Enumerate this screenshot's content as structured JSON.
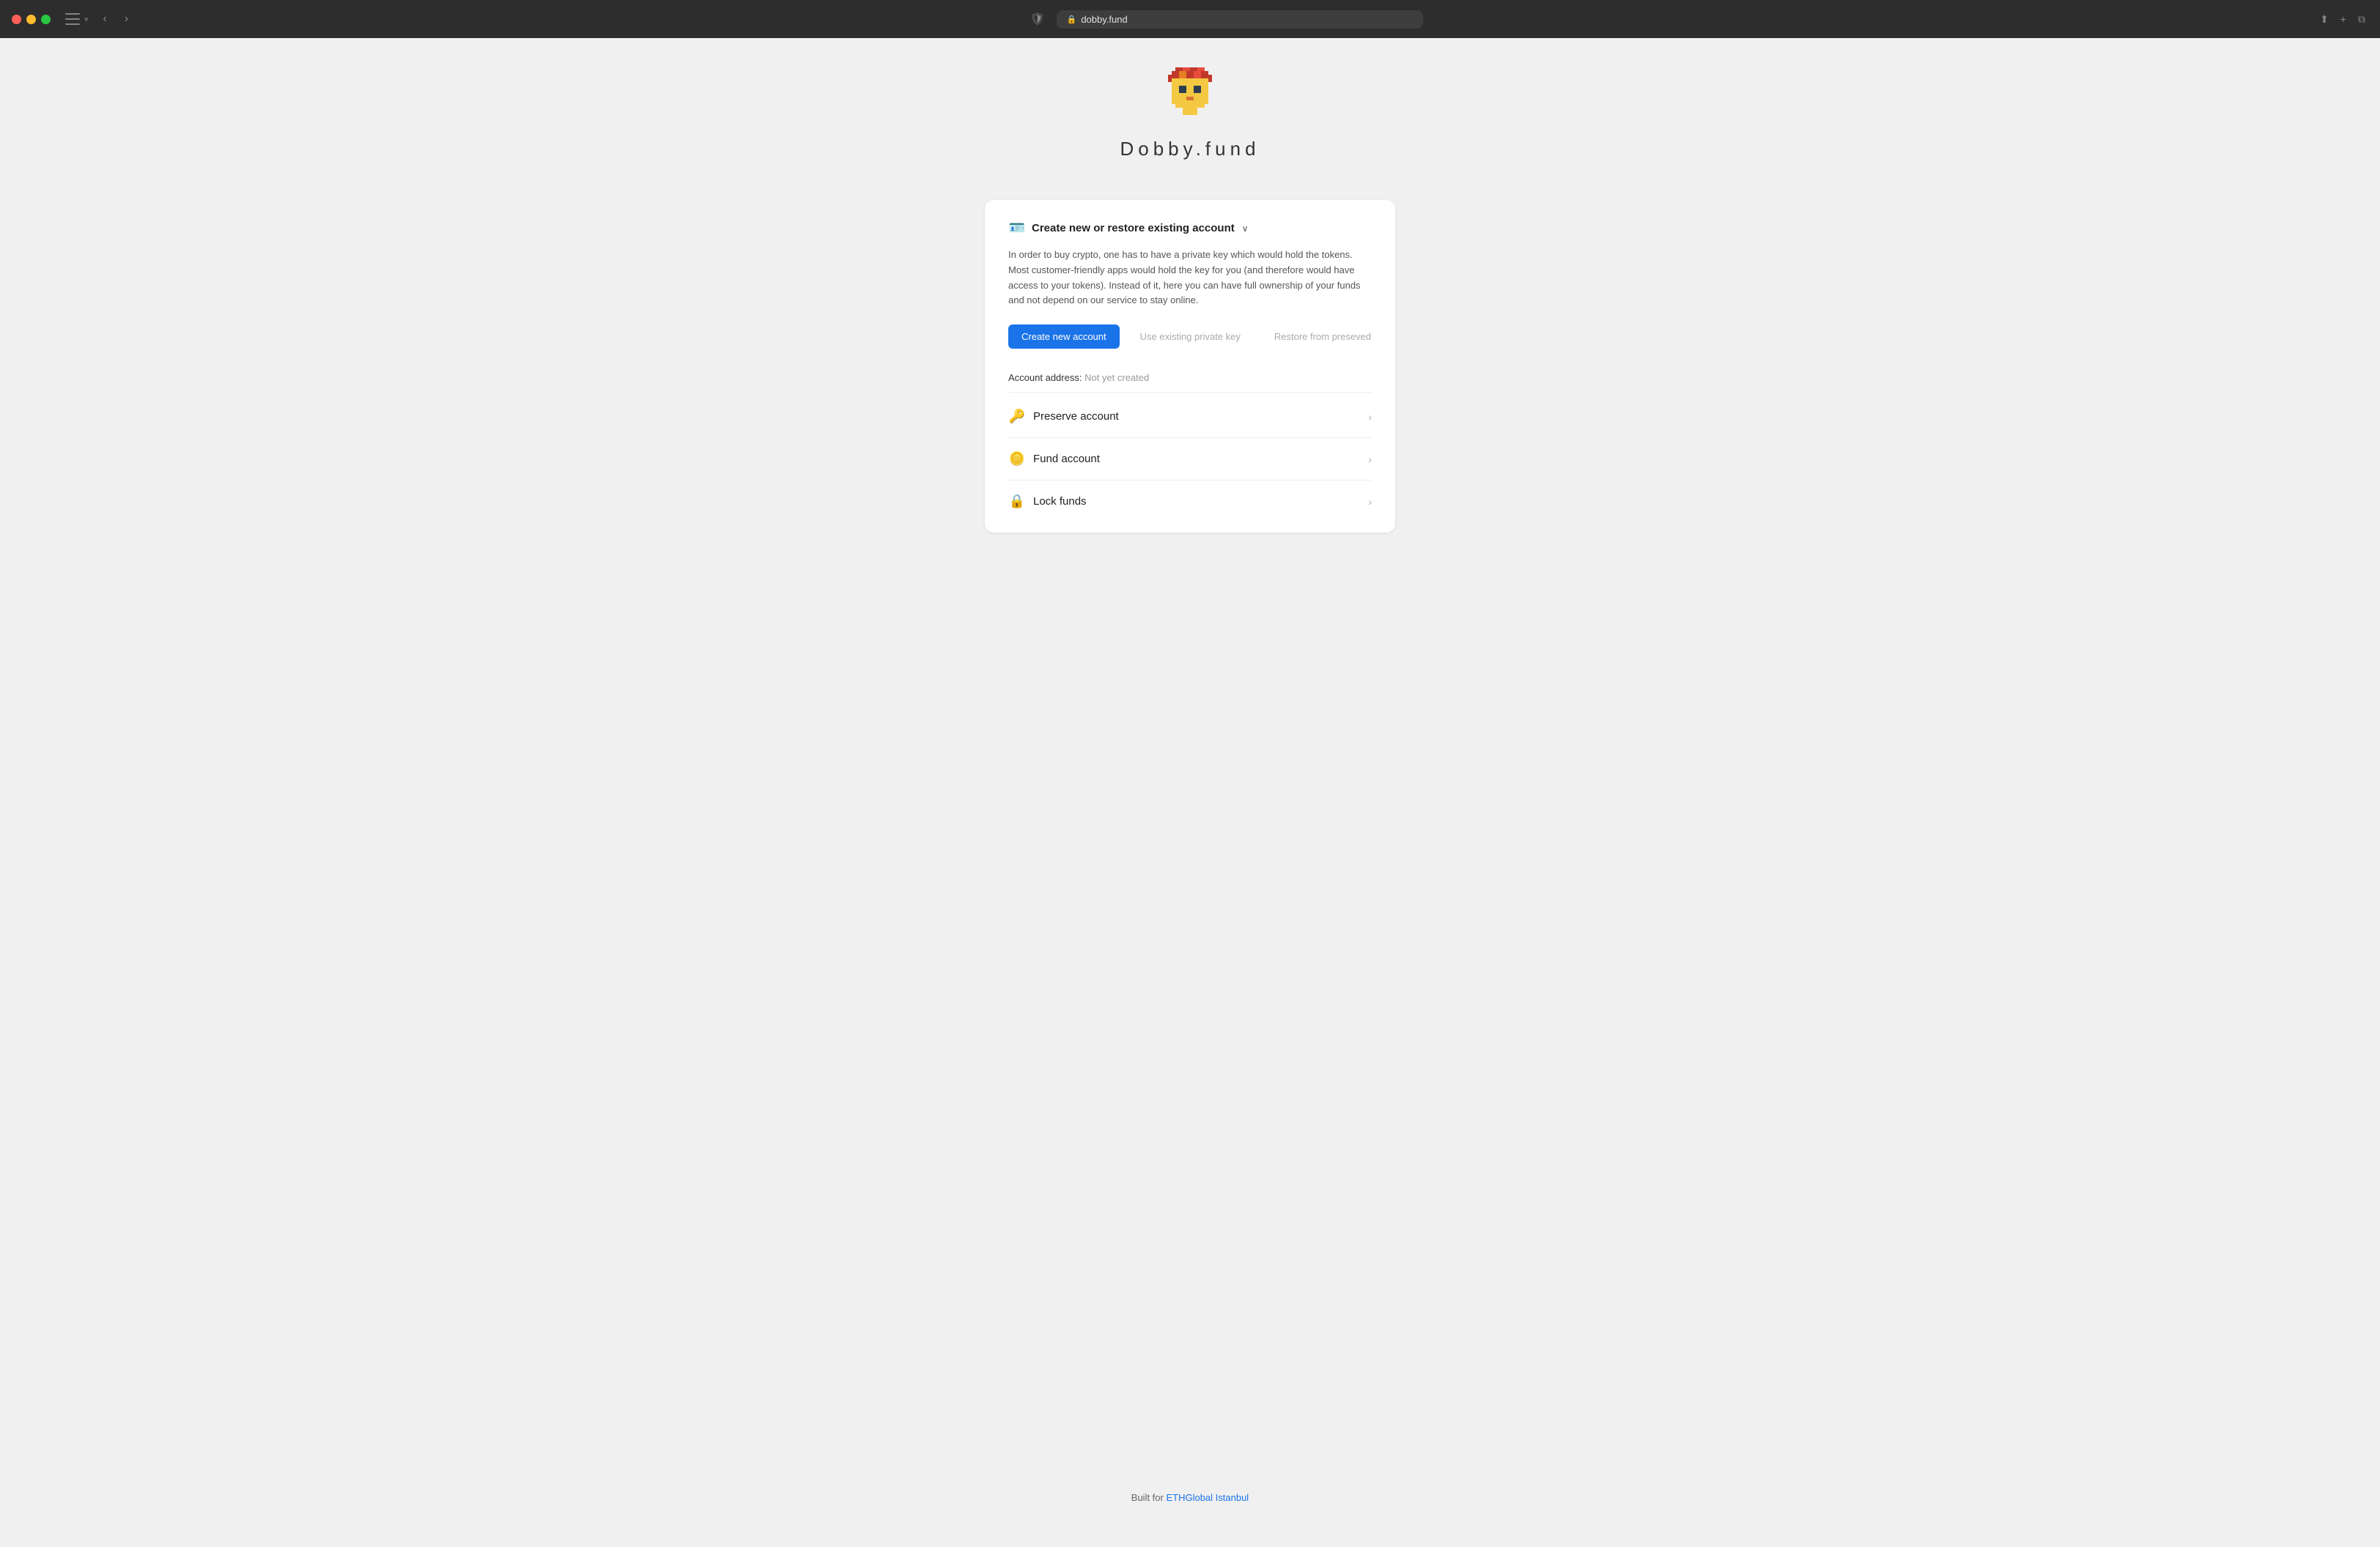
{
  "browser": {
    "url": "dobby.fund",
    "lock_symbol": "🔒",
    "shield_symbol": "🛡"
  },
  "site": {
    "title": "Dobby.fund",
    "footer_text": "Built for ",
    "footer_link_label": "ETHGlobal Istanbul",
    "footer_link_url": "#"
  },
  "card": {
    "header_icon": "🪪",
    "header_label": "Create new or restore existing account",
    "description": "In order to buy crypto, one has to have a private key which would hold the tokens. Most customer-friendly apps would hold the key for you (and therefore would have access to your tokens). Instead of it, here you can have full ownership of your funds and not depend on our service to stay online.",
    "btn_create": "Create new account",
    "btn_existing": "Use existing private key",
    "btn_restore": "Restore from preseved",
    "account_address_label": "Account address:",
    "account_address_value": "Not yet created",
    "rows": [
      {
        "emoji": "🔑",
        "label": "Preserve account"
      },
      {
        "emoji": "🪙",
        "label": "Fund account"
      },
      {
        "emoji": "🔒",
        "label": "Lock funds"
      }
    ]
  }
}
